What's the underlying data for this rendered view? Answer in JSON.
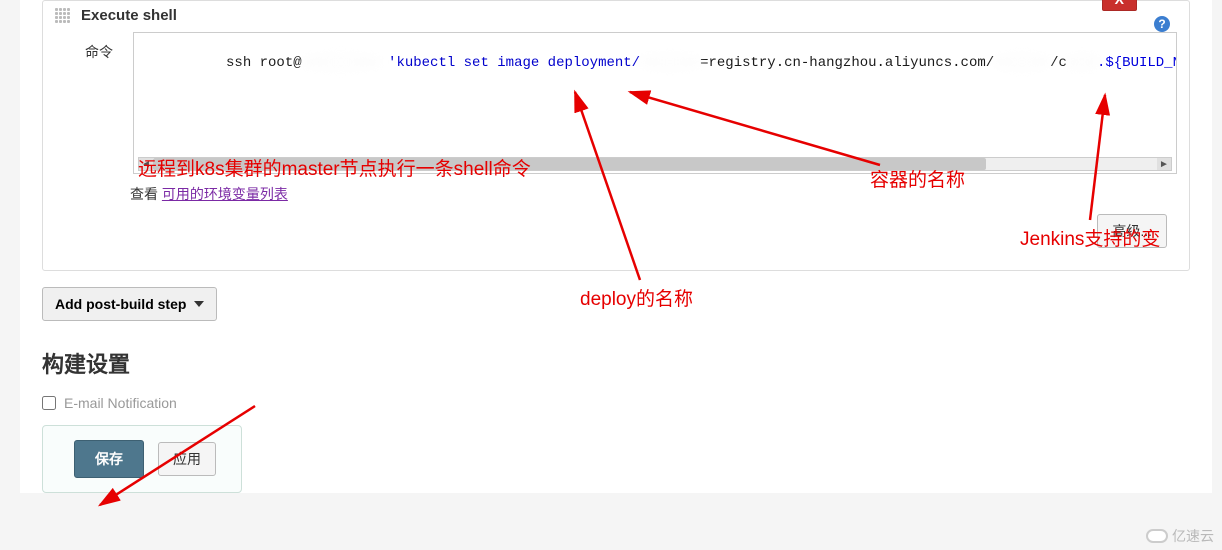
{
  "build_step": {
    "title": "Execute shell",
    "delete_label": "X",
    "field_label": "命令",
    "command_prefix": "ssh root@",
    "command_mid1": " 'kubectl set image deployment/",
    "command_mid2": "=registry.cn-hangzhou.aliyuncs.com/",
    "command_mid3": "/c",
    "command_var": ".${BUILD_NUMBE",
    "see_prefix": "查看 ",
    "see_link_label": "可用的环境变量列表",
    "advanced_label": "高级..."
  },
  "add_step": {
    "label": "Add post-build step"
  },
  "build_settings_heading": "构建设置",
  "email_notification": {
    "label": "E-mail Notification",
    "checked": false
  },
  "footer": {
    "save": "保存",
    "apply": "应用"
  },
  "annotations": {
    "a_master": "远程到k8s集群的master节点执行一条shell命令",
    "a_container": "容器的名称",
    "a_jenkins": "Jenkins支持的变",
    "a_deploy": "deploy的名称"
  },
  "watermark": "亿速云"
}
